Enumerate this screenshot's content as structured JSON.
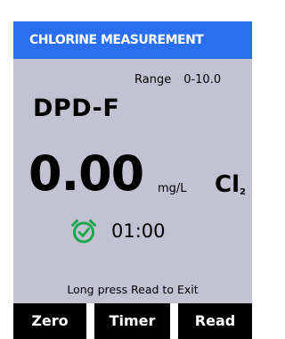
{
  "header": {
    "title": "CHLORINE MEASUREMENT"
  },
  "range": {
    "label": "Range",
    "value": "0-10.0"
  },
  "method": "DPD-F",
  "reading": {
    "value": "0.00",
    "units": "mg/L",
    "chemical": "Cl",
    "chemical_subscript": "2"
  },
  "timer": {
    "icon": "timer-clock-icon",
    "value": "01:00",
    "icon_color": "#1aa64a"
  },
  "hint": "Long press Read to Exit",
  "softkeys": {
    "zero": "Zero",
    "timer": "Timer",
    "read": "Read"
  },
  "colors": {
    "header_bg": "#2a6ff0",
    "panel_bg": "#c2c2d2",
    "softkey_bg": "#000000"
  }
}
